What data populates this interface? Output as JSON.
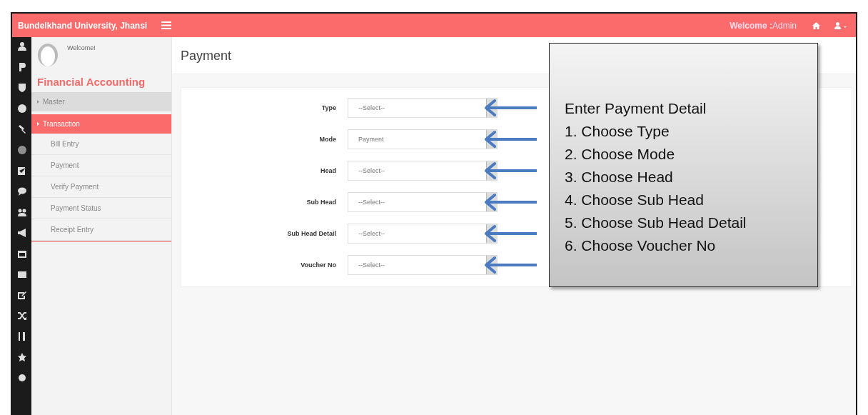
{
  "header": {
    "title": "Bundelkhand University, Jhansi",
    "welcome_label": "Welcome :",
    "user": "Admin"
  },
  "sidebar": {
    "greeting": "Welcome!",
    "section": "Financial Accounting",
    "items": [
      {
        "label": "Master",
        "selected": false
      },
      {
        "label": "Transaction",
        "selected": true,
        "children": [
          {
            "label": "Bill Entry",
            "selected": false
          },
          {
            "label": "Payment",
            "selected": false
          },
          {
            "label": "Verify Payment",
            "selected": false
          },
          {
            "label": "Payment Status",
            "selected": false
          },
          {
            "label": "Receipt Entry",
            "selected": false
          }
        ]
      }
    ]
  },
  "page_title": "Payment",
  "form": {
    "fields": [
      {
        "label": "Type",
        "value": "--Select--"
      },
      {
        "label": "Mode",
        "value": "Payment"
      },
      {
        "label": "Head",
        "value": "--Select--"
      },
      {
        "label": "Sub Head",
        "value": "--Select--"
      },
      {
        "label": "Sub Head Detail",
        "value": "--Select--"
      },
      {
        "label": "Voucher No",
        "value": "--Select--"
      }
    ]
  },
  "callout": {
    "title": "Enter Payment Detail",
    "steps": [
      "1. Choose Type",
      "2. Choose Mode",
      "3. Choose Head",
      "4. Choose Sub Head",
      "5. Choose Sub Head Detail",
      "6. Choose Voucher No"
    ]
  }
}
